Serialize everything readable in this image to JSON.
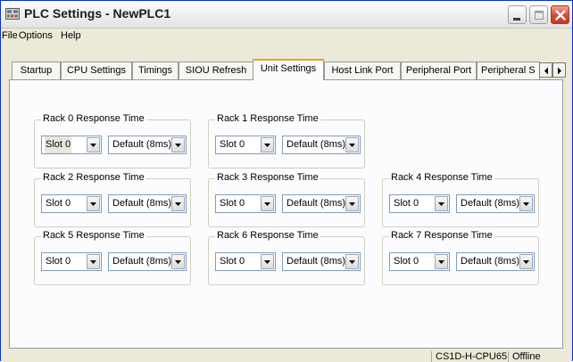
{
  "window": {
    "title": "PLC Settings - NewPLC1"
  },
  "menu": [
    "File",
    "Options",
    "Help"
  ],
  "tabs": [
    "Startup",
    "CPU Settings",
    "Timings",
    "SIOU Refresh",
    "Unit Settings",
    "Host Link Port",
    "Peripheral Port",
    "Peripheral S"
  ],
  "active_tab": "Unit Settings",
  "groups": [
    {
      "title": "Rack 0 Response Time",
      "slot": "Slot 0",
      "response": "Default (8ms)"
    },
    {
      "title": "Rack 1 Response Time",
      "slot": "Slot 0",
      "response": "Default (8ms)"
    },
    {
      "title": "Rack 2 Response Time",
      "slot": "Slot 0",
      "response": "Default (8ms)"
    },
    {
      "title": "Rack 3 Response Time",
      "slot": "Slot 0",
      "response": "Default (8ms)"
    },
    {
      "title": "Rack 4 Response Time",
      "slot": "Slot 0",
      "response": "Default (8ms)"
    },
    {
      "title": "Rack 5 Response Time",
      "slot": "Slot 0",
      "response": "Default (8ms)"
    },
    {
      "title": "Rack 6 Response Time",
      "slot": "Slot 0",
      "response": "Default (8ms)"
    },
    {
      "title": "Rack 7 Response Time",
      "slot": "Slot 0",
      "response": "Default (8ms)"
    }
  ],
  "status": {
    "model": "CS1D-H-CPU65",
    "mode": "Offline"
  },
  "icons": {
    "app": "plc-app-icon",
    "minimize": "minimize-icon",
    "maximize": "maximize-icon",
    "close": "close-icon",
    "scroll_left": "scroll-left-icon",
    "scroll_right": "scroll-right-icon",
    "dropdown": "dropdown-arrow-icon"
  },
  "colors": {
    "close_button": "#d24b32",
    "active_tab_accent": "#e6a02a",
    "window_face": "#ece9d8",
    "panel": "#fcfcfe"
  }
}
